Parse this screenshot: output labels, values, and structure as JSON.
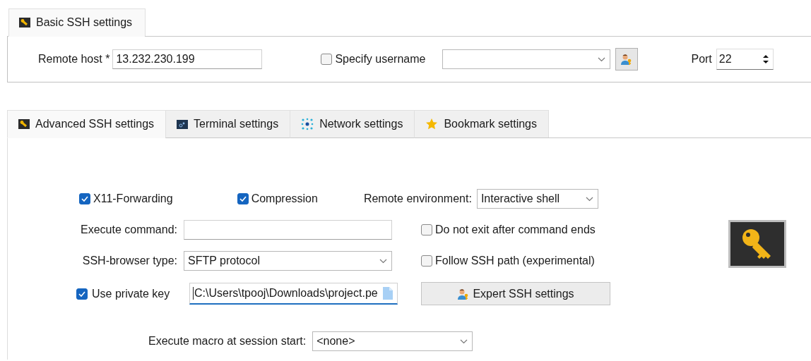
{
  "basic_tab": {
    "label": "Basic SSH settings",
    "selected": true
  },
  "basic": {
    "remote_host": {
      "label": "Remote host *",
      "value": "13.232.230.199"
    },
    "specify_username": {
      "label": "Specify username",
      "checked": false
    },
    "port": {
      "label": "Port",
      "value": "22"
    }
  },
  "tabs": [
    {
      "label": "Advanced SSH settings",
      "selected": true
    },
    {
      "label": "Terminal settings",
      "selected": false
    },
    {
      "label": "Network settings",
      "selected": false
    },
    {
      "label": "Bookmark settings",
      "selected": false
    }
  ],
  "advanced": {
    "x11_forwarding": {
      "label": "X11-Forwarding",
      "checked": true
    },
    "compression": {
      "label": "Compression",
      "checked": true
    },
    "remote_environment": {
      "label": "Remote environment:",
      "value": "Interactive shell"
    },
    "execute_command": {
      "label": "Execute command:"
    },
    "do_not_exit": {
      "label": "Do not exit after command ends",
      "checked": false
    },
    "browser_type": {
      "label": "SSH-browser type:",
      "value": "SFTP protocol"
    },
    "follow_path": {
      "label": "Follow SSH path (experimental)",
      "checked": false
    },
    "private_key": {
      "label": "Use private key",
      "checked": true,
      "value": "C:\\Users\\tpooj\\Downloads\\project.pe"
    },
    "expert_button": {
      "label": "Expert SSH settings"
    },
    "macro": {
      "label": "Execute macro at session start:",
      "value": "<none>"
    }
  }
}
